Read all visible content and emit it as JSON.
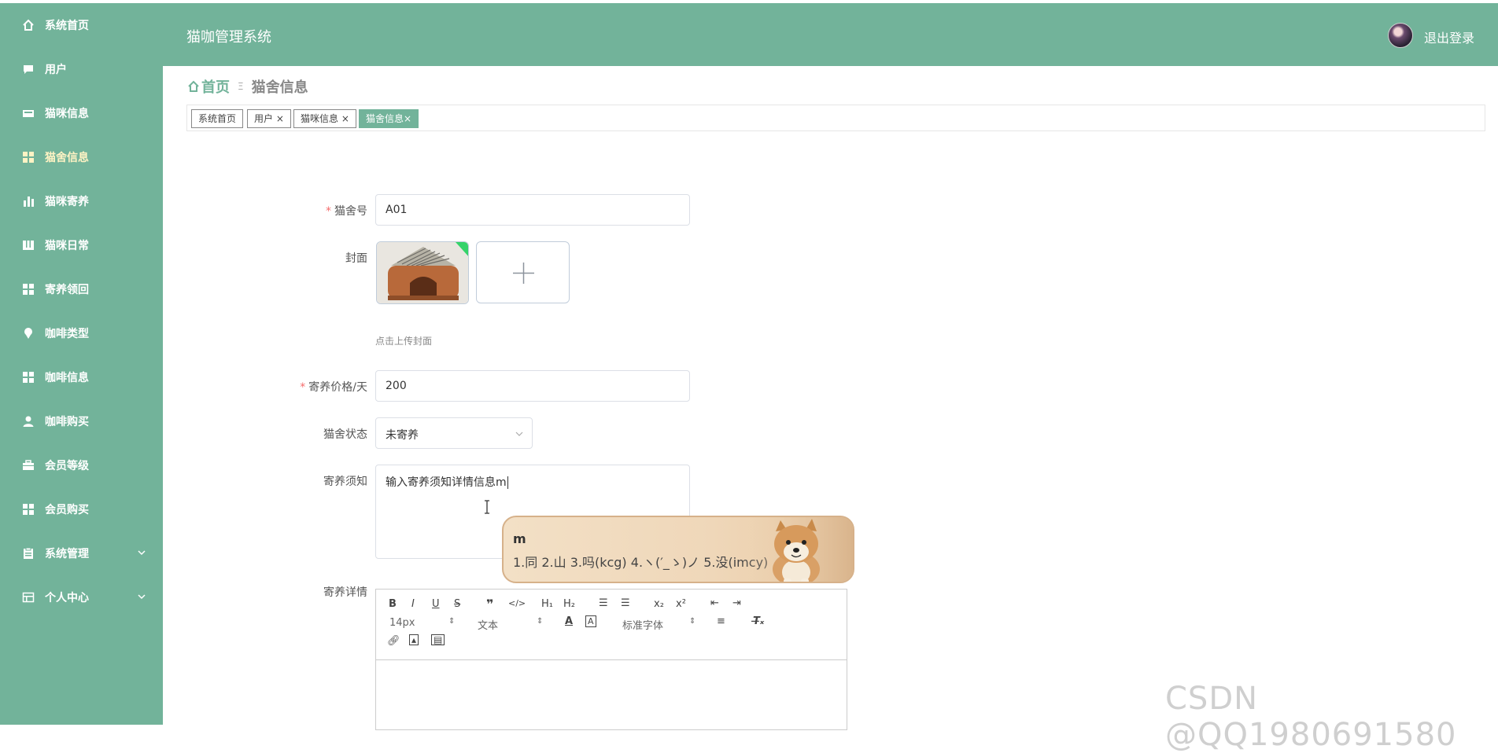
{
  "header": {
    "title": "猫咖管理系统",
    "logout_label": "退出登录"
  },
  "sidebar": {
    "items": [
      {
        "label": "系统首页",
        "icon": "home-icon"
      },
      {
        "label": "用户",
        "icon": "chat-icon"
      },
      {
        "label": "猫咪信息",
        "icon": "card-icon"
      },
      {
        "label": "猫舍信息",
        "icon": "grid-icon",
        "active": true
      },
      {
        "label": "猫咪寄养",
        "icon": "bar-chart-icon"
      },
      {
        "label": "猫咪日常",
        "icon": "columns-icon"
      },
      {
        "label": "寄养领回",
        "icon": "grid-icon"
      },
      {
        "label": "咖啡类型",
        "icon": "pin-icon"
      },
      {
        "label": "咖啡信息",
        "icon": "grid-icon"
      },
      {
        "label": "咖啡购买",
        "icon": "user-icon"
      },
      {
        "label": "会员等级",
        "icon": "briefcase-icon"
      },
      {
        "label": "会员购买",
        "icon": "grid-icon"
      },
      {
        "label": "系统管理",
        "icon": "clipboard-icon",
        "expandable": true
      },
      {
        "label": "个人中心",
        "icon": "window-icon",
        "expandable": true
      }
    ]
  },
  "breadcrumb": {
    "home": "首页",
    "separator": "Ξ",
    "current": "猫舍信息"
  },
  "tags": [
    {
      "label": "系统首页",
      "closable": false
    },
    {
      "label": "用户",
      "closable": true
    },
    {
      "label": "猫咪信息",
      "closable": true
    },
    {
      "label": "猫舍信息",
      "closable": true,
      "active": true
    }
  ],
  "form": {
    "house_no": {
      "label": "猫舍号",
      "required": true,
      "value": "A01"
    },
    "cover": {
      "label": "封面",
      "hint": "点击上传封面"
    },
    "price": {
      "label": "寄养价格/天",
      "required": true,
      "value": "200"
    },
    "status": {
      "label": "猫舍状态",
      "value": "未寄养"
    },
    "notice": {
      "label": "寄养须知",
      "value": "输入寄养须知详情信息m"
    },
    "details": {
      "label": "寄养详情"
    }
  },
  "editor": {
    "font_size": "14px",
    "paragraph": "文本",
    "font_family": "标准字体"
  },
  "ime": {
    "typed": "m",
    "candidates": "1.同  2.山  3.吗(kcg)  4.ヽ(′_ゝ)ノ  5.没(imcy)"
  },
  "watermark": "CSDN @QQ1980691580",
  "colors": {
    "theme": "#72b39a",
    "required": "#f56c6c"
  }
}
